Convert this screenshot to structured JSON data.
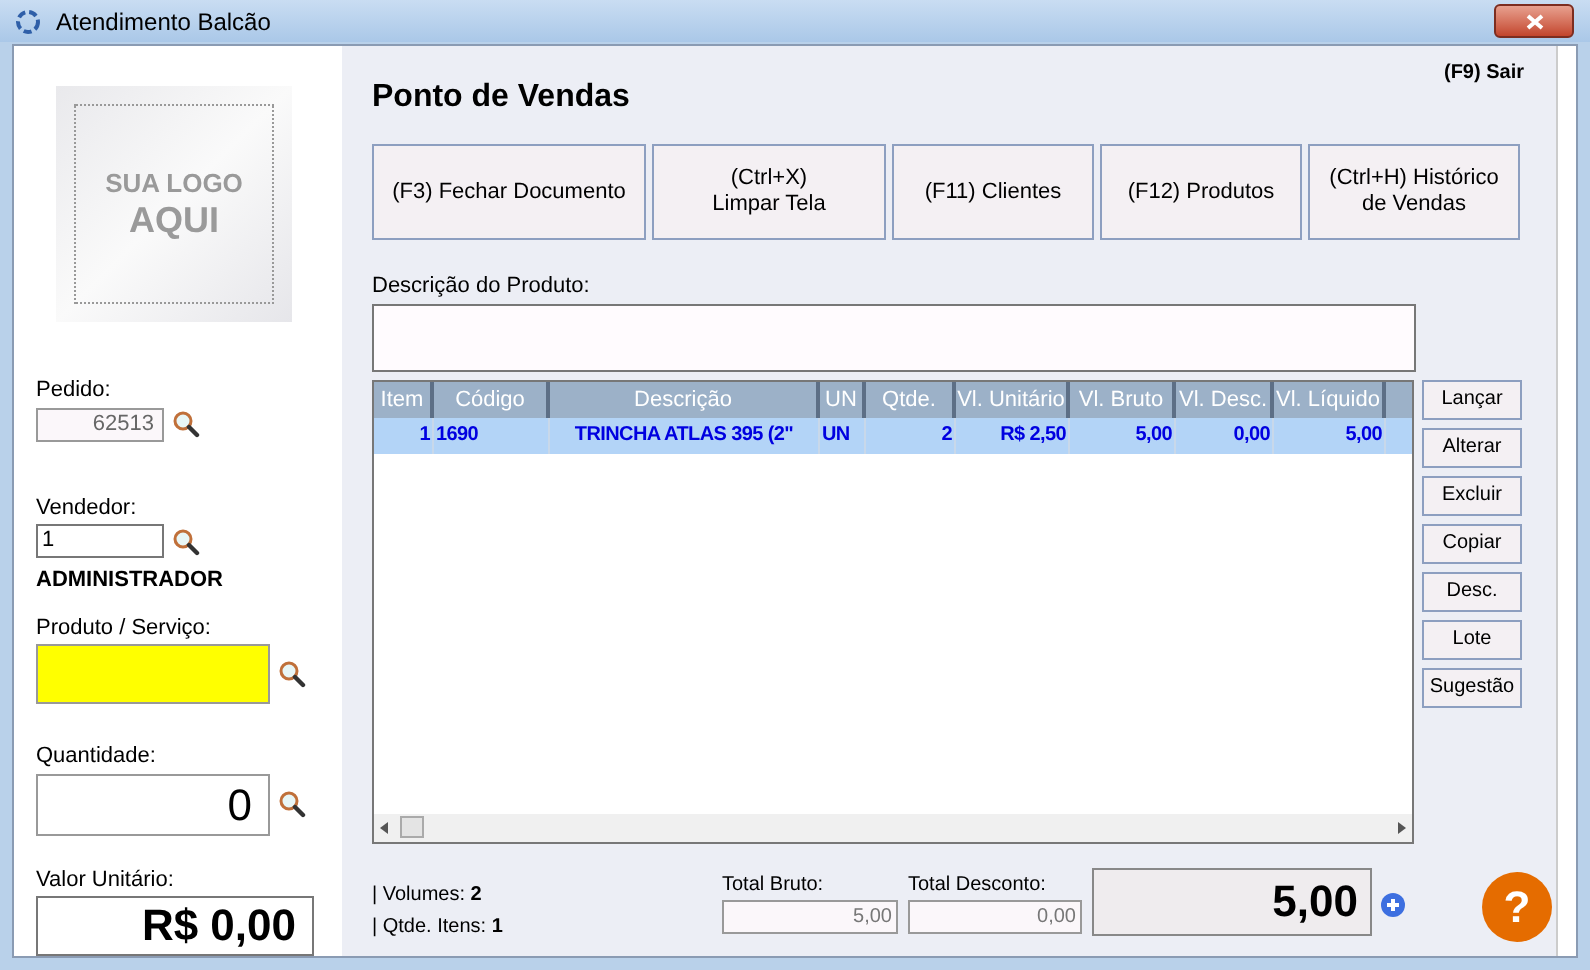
{
  "window": {
    "title": "Atendimento Balcão"
  },
  "logo": {
    "lines": [
      "SUA LOGO",
      "AQUI"
    ]
  },
  "left": {
    "pedido": {
      "label": "Pedido:",
      "value": "62513"
    },
    "vendedor": {
      "label": "Vendedor:",
      "value": "1",
      "name": "ADMINISTRADOR"
    },
    "produto": {
      "label": "Produto / Serviço:"
    },
    "quantidade": {
      "label": "Quantidade:",
      "value": "0"
    },
    "valor_unitario": {
      "label": "Valor Unitário:",
      "value": "R$ 0,00"
    }
  },
  "header": {
    "title": "Ponto de Vendas",
    "exit": "(F9) Sair"
  },
  "actions": [
    {
      "lines": [
        "(F3) Fechar Documento"
      ]
    },
    {
      "lines": [
        "(Ctrl+X)",
        "Limpar Tela"
      ]
    },
    {
      "lines": [
        "(F11) Clientes"
      ]
    },
    {
      "lines": [
        "(F12) Produtos"
      ]
    },
    {
      "lines": [
        "(Ctrl+H) Histórico",
        "de Vendas"
      ]
    }
  ],
  "description_field": {
    "label": "Descrição do Produto:"
  },
  "table": {
    "columns": [
      "Item",
      "Código",
      "Descrição",
      "UN",
      "Qtde.",
      "Vl. Unitário",
      "Vl. Bruto",
      "Vl. Desc.",
      "Vl. Líquido"
    ],
    "rows": [
      {
        "selected": true,
        "cells": [
          "1",
          "1690",
          "TRINCHA ATLAS 395 (2\"",
          "UN",
          "2",
          "R$ 2,50",
          "5,00",
          "0,00",
          "5,00"
        ]
      }
    ]
  },
  "side_buttons": [
    "Lançar",
    "Alterar",
    "Excluir",
    "Copiar",
    "Desc.",
    "Lote",
    "Sugestão"
  ],
  "summary": {
    "volumes_label": "| Volumes:",
    "volumes": "2",
    "items_label": "| Qtde. Itens:",
    "items": "1"
  },
  "totals": {
    "bruto": {
      "label": "Total Bruto:",
      "value": "5,00"
    },
    "desconto": {
      "label": "Total Desconto:",
      "value": "0,00"
    },
    "total": "5,00"
  },
  "help": "?"
}
